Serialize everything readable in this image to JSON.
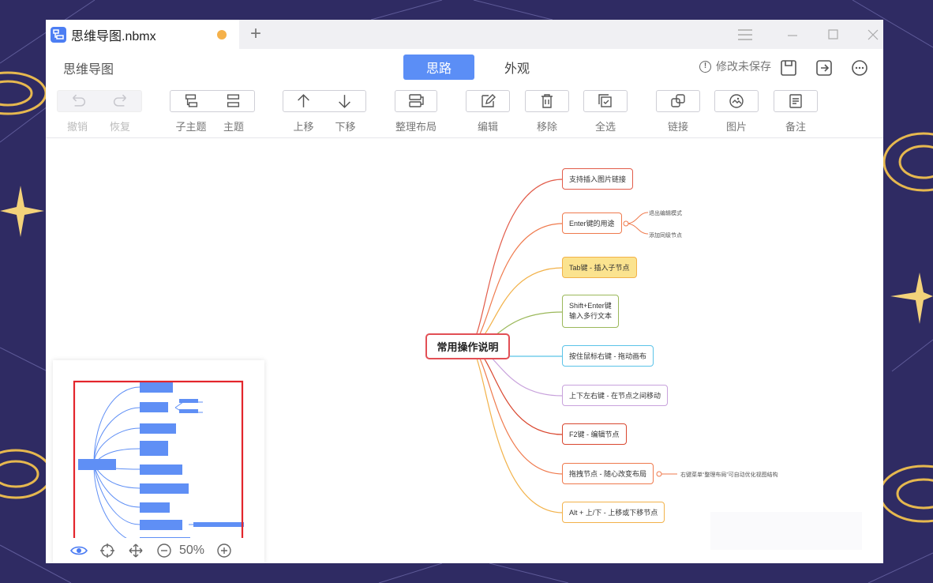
{
  "window": {
    "tab_title": "思维导图.nbmx",
    "app_title": "思维导图",
    "colors": {
      "accent": "#5b8ef6",
      "unsaved_dot": "#f5b14a",
      "root_border": "#e24f55"
    }
  },
  "modes": {
    "active": "思路",
    "inactive": "外观"
  },
  "status": {
    "save_text": "修改未保存"
  },
  "toolbar": {
    "undo": "撤销",
    "redo": "恢复",
    "child_topic": "子主题",
    "topic": "主题",
    "move_up": "上移",
    "move_down": "下移",
    "tidy_layout": "整理布局",
    "edit": "编辑",
    "remove": "移除",
    "select_all": "全选",
    "link": "链接",
    "image": "图片",
    "note": "备注"
  },
  "mindmap": {
    "root": "常用操作说明",
    "branches": [
      {
        "label": "支持插入图片链接",
        "color": "#e25c4a"
      },
      {
        "label": "Enter键的用途",
        "color": "#ef7a4d",
        "children": [
          "退出编辑模式",
          "添加同级节点"
        ]
      },
      {
        "label": "Tab键 - 插入子节点",
        "color": "#f2b24a"
      },
      {
        "label1": "Shift+Enter键",
        "label2": "输入多行文本",
        "color": "#9bb85a"
      },
      {
        "label": "按住鼠标右键 - 拖动画布",
        "color": "#5bc3e8"
      },
      {
        "label": "上下左右键 - 在节点之间移动",
        "color": "#c8a2dc"
      },
      {
        "label": "F2键 - 编辑节点",
        "color": "#d9472f"
      },
      {
        "label": "拖拽节点 - 随心改变布局",
        "color": "#ef7a4d",
        "children": [
          "右键菜单“整理布局”可自动优化视图结构"
        ]
      },
      {
        "label": "Alt + 上/下  -  上移或下移节点",
        "color": "#f2b24a"
      }
    ]
  },
  "minimap": {
    "zoom": "50%"
  }
}
